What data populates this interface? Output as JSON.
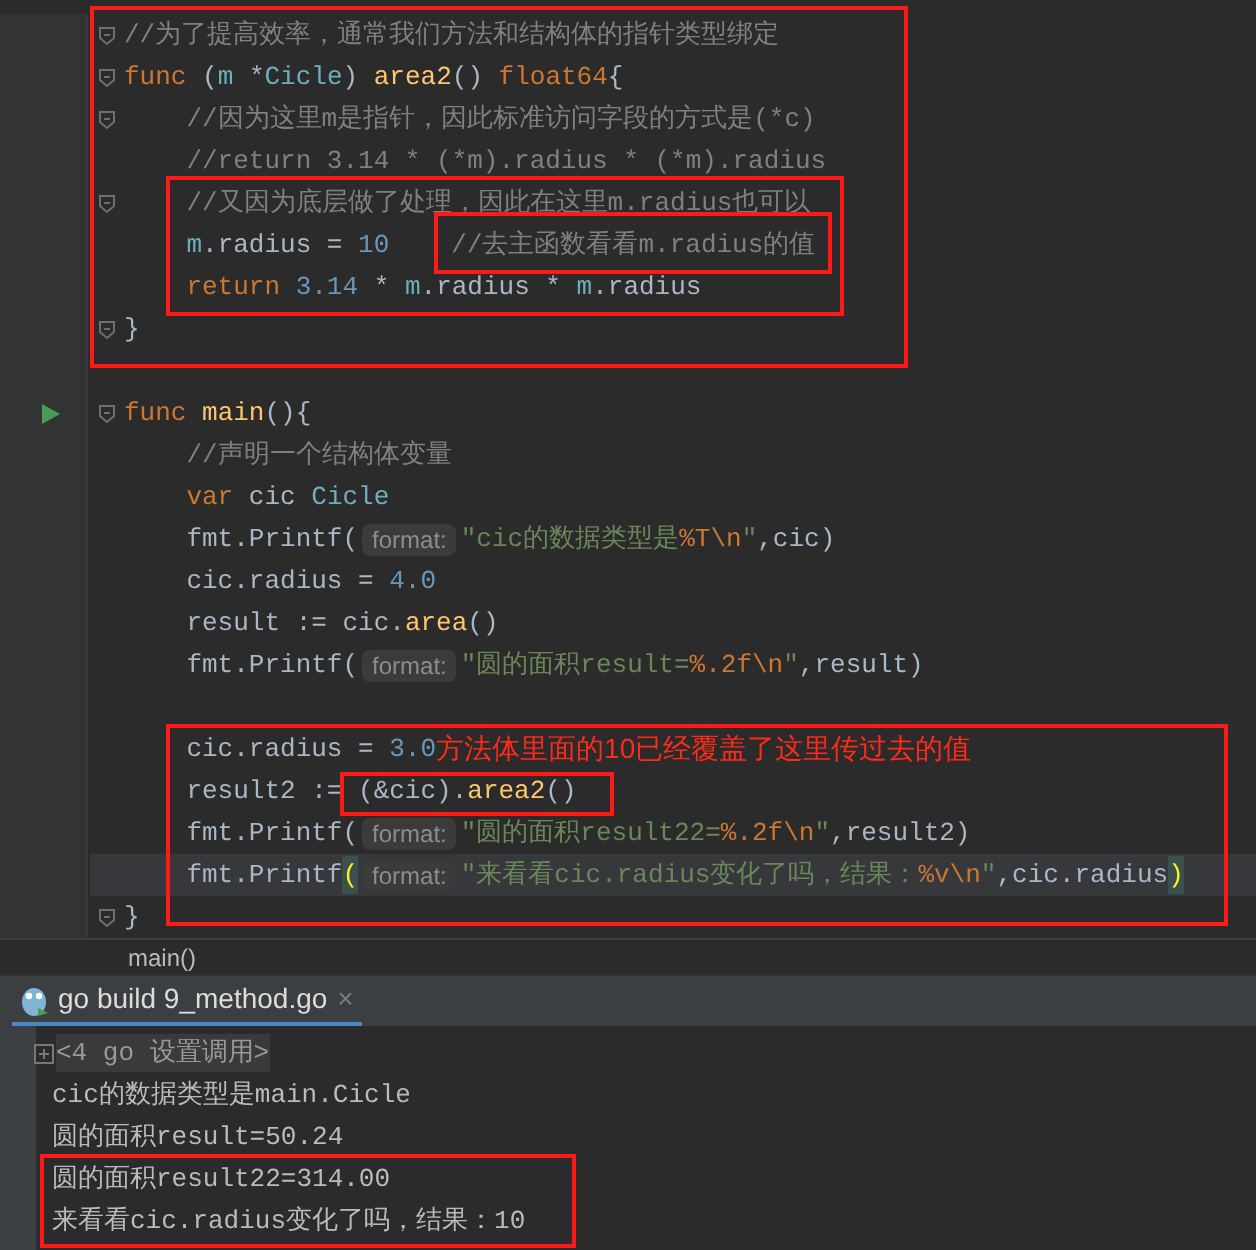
{
  "editor": {
    "lines": [
      {
        "fold": true,
        "run": false,
        "current": false,
        "tokens": [
          {
            "kind": "comment",
            "text": "//为了提高效率，通常我们方法和结构体的指针类型绑定"
          }
        ]
      },
      {
        "fold": true,
        "run": false,
        "current": false,
        "tokens": [
          {
            "kind": "keyword",
            "text": "func "
          },
          {
            "kind": "plain",
            "text": "("
          },
          {
            "kind": "param",
            "text": "m"
          },
          {
            "kind": "plain",
            "text": " *"
          },
          {
            "kind": "type",
            "text": "Cicle"
          },
          {
            "kind": "plain",
            "text": ") "
          },
          {
            "kind": "func",
            "text": "area2"
          },
          {
            "kind": "plain",
            "text": "() "
          },
          {
            "kind": "keyword",
            "text": "float64"
          },
          {
            "kind": "plain",
            "text": "{"
          }
        ]
      },
      {
        "fold": true,
        "run": false,
        "current": false,
        "tokens": [
          {
            "kind": "comment",
            "text": "    //因为这里m是指针，因此标准访问字段的方式是(*c)"
          }
        ]
      },
      {
        "fold": false,
        "run": false,
        "current": false,
        "tokens": [
          {
            "kind": "comment",
            "text": "    //return 3.14 * (*m).radius * (*m).radius"
          }
        ]
      },
      {
        "fold": true,
        "run": false,
        "current": false,
        "tokens": [
          {
            "kind": "comment",
            "text": "    //又因为底层做了处理，因此在这里m.radius也可以"
          }
        ]
      },
      {
        "fold": false,
        "run": false,
        "current": false,
        "tokens": [
          {
            "kind": "param",
            "text": "    m"
          },
          {
            "kind": "plain",
            "text": ".radius = "
          },
          {
            "kind": "number",
            "text": "10"
          },
          {
            "kind": "trailing_comment",
            "text": "//去主函数看看m.radius的值"
          }
        ]
      },
      {
        "fold": false,
        "run": false,
        "current": false,
        "tokens": [
          {
            "kind": "keyword",
            "text": "    return "
          },
          {
            "kind": "number",
            "text": "3.14"
          },
          {
            "kind": "plain",
            "text": " * "
          },
          {
            "kind": "param",
            "text": "m"
          },
          {
            "kind": "plain",
            "text": ".radius * "
          },
          {
            "kind": "param",
            "text": "m"
          },
          {
            "kind": "plain",
            "text": ".radius"
          }
        ]
      },
      {
        "fold": true,
        "run": false,
        "current": false,
        "tokens": [
          {
            "kind": "plain",
            "text": "}"
          }
        ]
      },
      {
        "fold": false,
        "run": false,
        "current": false
      },
      {
        "fold": true,
        "run": true,
        "current": false,
        "tokens": [
          {
            "kind": "keyword",
            "text": "func "
          },
          {
            "kind": "func",
            "text": "main"
          },
          {
            "kind": "plain",
            "text": "(){"
          }
        ]
      },
      {
        "fold": false,
        "run": false,
        "current": false,
        "tokens": [
          {
            "kind": "comment",
            "text": "    //声明一个结构体变量"
          }
        ]
      },
      {
        "fold": false,
        "run": false,
        "current": false,
        "tokens": [
          {
            "kind": "keyword",
            "text": "    var "
          },
          {
            "kind": "plain",
            "text": "cic "
          },
          {
            "kind": "type",
            "text": "Cicle"
          }
        ]
      },
      {
        "fold": false,
        "run": false,
        "current": false,
        "tokens": [
          {
            "kind": "plain",
            "text": "    fmt.Printf("
          },
          {
            "kind": "hint",
            "text": "format:"
          },
          {
            "kind": "string",
            "text": "\"cic的数据类型是"
          },
          {
            "kind": "escape",
            "text": "%T\\n"
          },
          {
            "kind": "string",
            "text": "\""
          },
          {
            "kind": "plain",
            "text": ",cic)"
          }
        ]
      },
      {
        "fold": false,
        "run": false,
        "current": false,
        "tokens": [
          {
            "kind": "plain",
            "text": "    cic.radius = "
          },
          {
            "kind": "number",
            "text": "4.0"
          }
        ]
      },
      {
        "fold": false,
        "run": false,
        "current": false,
        "tokens": [
          {
            "kind": "plain",
            "text": "    result := cic."
          },
          {
            "kind": "func",
            "text": "area"
          },
          {
            "kind": "plain",
            "text": "()"
          }
        ]
      },
      {
        "fold": false,
        "run": false,
        "current": false,
        "tokens": [
          {
            "kind": "plain",
            "text": "    fmt.Printf("
          },
          {
            "kind": "hint",
            "text": "format:"
          },
          {
            "kind": "string",
            "text": "\"圆的面积result="
          },
          {
            "kind": "escape",
            "text": "%.2f\\n"
          },
          {
            "kind": "string",
            "text": "\""
          },
          {
            "kind": "plain",
            "text": ",result)"
          }
        ]
      },
      {
        "fold": false,
        "run": false,
        "current": false
      },
      {
        "fold": false,
        "run": false,
        "current": false,
        "tokens": [
          {
            "kind": "plain",
            "text": "    cic.radius = "
          },
          {
            "kind": "number",
            "text": "3.0"
          },
          {
            "kind": "note",
            "text": "方法体里面的10已经覆盖了这里传过去的值"
          }
        ]
      },
      {
        "fold": false,
        "run": false,
        "current": false,
        "tokens": [
          {
            "kind": "plain",
            "text": "    result2 := "
          },
          {
            "kind": "plain",
            "text": "(&cic)."
          },
          {
            "kind": "func",
            "text": "area2"
          },
          {
            "kind": "plain",
            "text": "()"
          }
        ]
      },
      {
        "fold": false,
        "run": false,
        "current": false,
        "tokens": [
          {
            "kind": "plain",
            "text": "    fmt.Printf("
          },
          {
            "kind": "hint",
            "text": "format:"
          },
          {
            "kind": "string",
            "text": "\"圆的面积result22="
          },
          {
            "kind": "escape",
            "text": "%.2f\\n"
          },
          {
            "kind": "string",
            "text": "\""
          },
          {
            "kind": "plain",
            "text": ",result2)"
          }
        ]
      },
      {
        "fold": false,
        "run": false,
        "current": true,
        "tokens": [
          {
            "kind": "plain",
            "text": "    fmt.Printf"
          },
          {
            "kind": "brace",
            "text": "("
          },
          {
            "kind": "hint",
            "text": "format:"
          },
          {
            "kind": "string",
            "text": "\"来看看cic.radius变化了吗，结果："
          },
          {
            "kind": "escape",
            "text": "%v\\n"
          },
          {
            "kind": "string",
            "text": "\""
          },
          {
            "kind": "plain",
            "text": ",cic.radius"
          },
          {
            "kind": "brace",
            "text": ")"
          }
        ]
      },
      {
        "fold": true,
        "run": false,
        "current": false,
        "tokens": [
          {
            "kind": "plain",
            "text": "}"
          }
        ]
      }
    ]
  },
  "breadcrumb": "main()",
  "run_tab": {
    "label": "go build 9_method.go",
    "close": "×"
  },
  "console": {
    "lines": [
      {
        "kind": "folded",
        "text": "<4 go 设置调用>"
      },
      {
        "kind": "output",
        "text": "cic的数据类型是main.Cicle"
      },
      {
        "kind": "output",
        "text": "圆的面积result=50.24"
      },
      {
        "kind": "output",
        "text": "圆的面积result22=314.00"
      },
      {
        "kind": "output",
        "text": "来看看cic.radius变化了吗，结果：10"
      }
    ]
  }
}
